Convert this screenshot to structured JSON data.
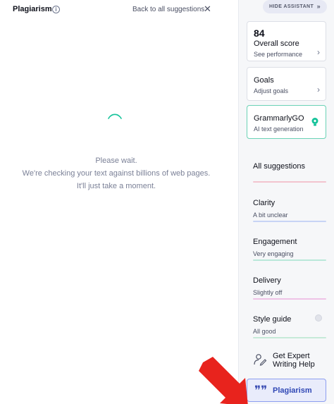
{
  "left_panel": {
    "title": "Plagiarism",
    "info_icon": "info-icon",
    "back_link": "Back to all suggestions",
    "close_icon": "close-icon",
    "wait_lines": [
      "Please wait.",
      "We're checking your text against billions of web pages.",
      "It'll just take a moment."
    ]
  },
  "sidebar": {
    "hide_button": "HIDE ASSISTANT",
    "hide_chevron": "»",
    "score_card": {
      "score": "84",
      "label": "Overall score",
      "link": "See performance"
    },
    "goals_card": {
      "label": "Goals",
      "link": "Adjust goals"
    },
    "go_card": {
      "label": "GrammarlyGO",
      "sub": "AI text generation",
      "icon": "lightbulb-icon"
    },
    "categories": [
      {
        "label": "All suggestions",
        "sub": "",
        "color": "#f3c4cf"
      },
      {
        "label": "Clarity",
        "sub": "A bit unclear",
        "color": "#c7d4f5"
      },
      {
        "label": "Engagement",
        "sub": "Very engaging",
        "color": "#b9e8d9"
      },
      {
        "label": "Delivery",
        "sub": "Slightly off",
        "color": "#efc3e6"
      },
      {
        "label": "Style guide",
        "sub": "All good",
        "color": "#c6ead8"
      }
    ],
    "expert": {
      "line1": "Get Expert",
      "line2": "Writing Help",
      "icon": "expert-writer-icon"
    },
    "plagiarism_button": {
      "label": "Plagiarism",
      "icon": "quote-icon"
    }
  },
  "colors": {
    "accent": "#2f47b5",
    "go_border": "#6bd2b5",
    "spinner": "#15c39a",
    "annotation_arrow": "#e8231d"
  }
}
